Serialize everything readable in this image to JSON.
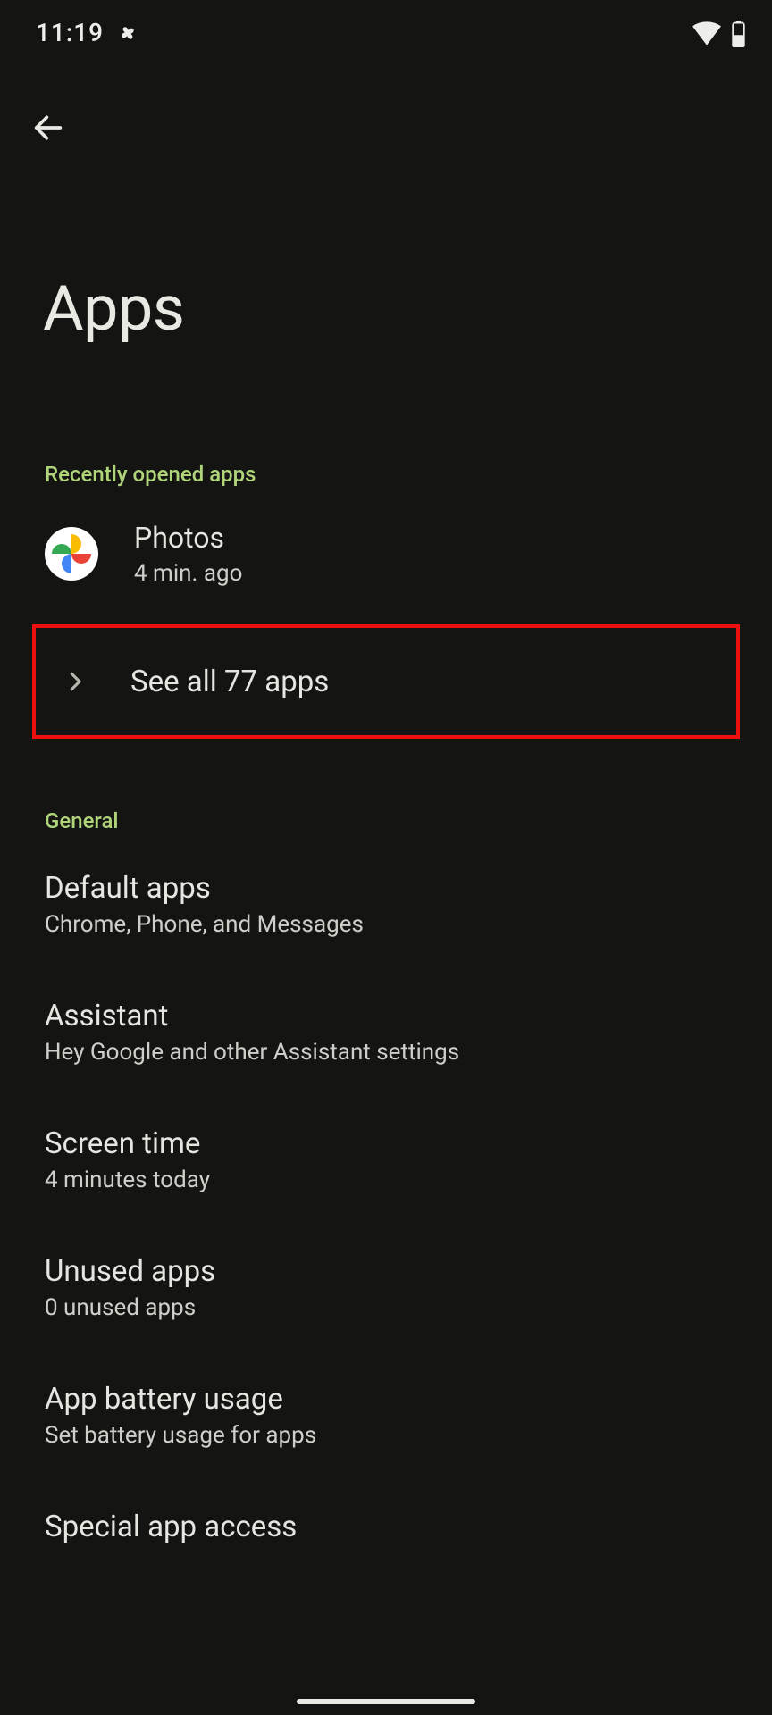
{
  "status_bar": {
    "time": "11:19"
  },
  "header": {
    "title": "Apps"
  },
  "recent": {
    "label": "Recently opened apps",
    "app": {
      "name": "Photos",
      "sub": "4 min. ago"
    },
    "see_all": "See all 77 apps"
  },
  "general": {
    "label": "General",
    "items": [
      {
        "title": "Default apps",
        "sub": "Chrome, Phone, and Messages"
      },
      {
        "title": "Assistant",
        "sub": "Hey Google and other Assistant settings"
      },
      {
        "title": "Screen time",
        "sub": "4 minutes today"
      },
      {
        "title": "Unused apps",
        "sub": "0 unused apps"
      },
      {
        "title": "App battery usage",
        "sub": "Set battery usage for apps"
      }
    ],
    "partial": "Special app access"
  }
}
